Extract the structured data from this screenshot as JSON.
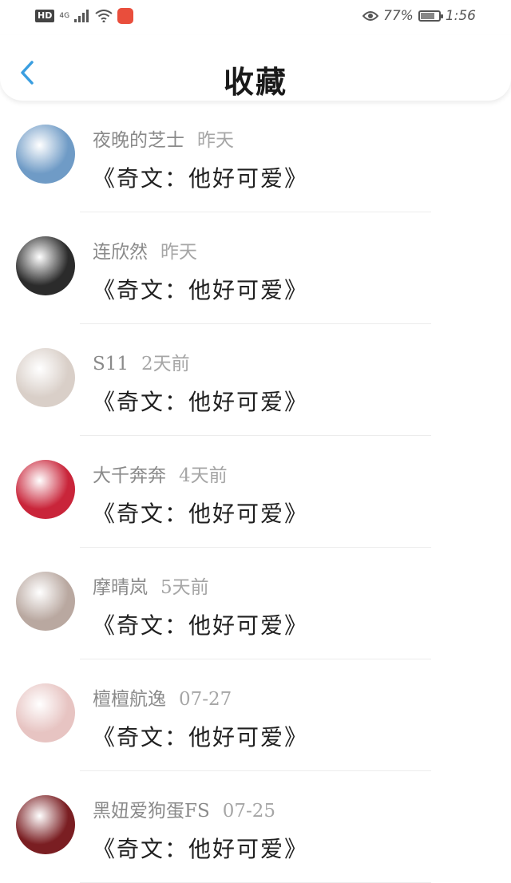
{
  "status": {
    "hd": "HD",
    "network": "4G",
    "battery_percent": "77%",
    "time": "1:56",
    "battery_level": 0.77
  },
  "header": {
    "title": "收藏",
    "back_icon": "chevron-left-icon",
    "accent_color": "#3a9ee0"
  },
  "favorites": [
    {
      "user": "夜晚的芝士",
      "time": "昨天",
      "content": "《奇文：他好可爱》",
      "avatar_color": "#6f9bc6"
    },
    {
      "user": "连欣然",
      "time": "昨天",
      "content": "《奇文：他好可爱》",
      "avatar_color": "#2b2b2b"
    },
    {
      "user": "S11",
      "time": "2天前",
      "content": "《奇文：他好可爱》",
      "avatar_color": "#d9cfc8"
    },
    {
      "user": "大千奔奔",
      "time": "4天前",
      "content": "《奇文：他好可爱》",
      "avatar_color": "#c9253a"
    },
    {
      "user": "摩晴岚",
      "time": "5天前",
      "content": "《奇文：他好可爱》",
      "avatar_color": "#b9a8a0"
    },
    {
      "user": "檀檀航逸",
      "time": "07-27",
      "content": "《奇文：他好可爱》",
      "avatar_color": "#e7c4c2"
    },
    {
      "user": "黑妞爱狗蛋FS",
      "time": "07-25",
      "content": "《奇文：他好可爱》",
      "avatar_color": "#7a1e22"
    }
  ]
}
